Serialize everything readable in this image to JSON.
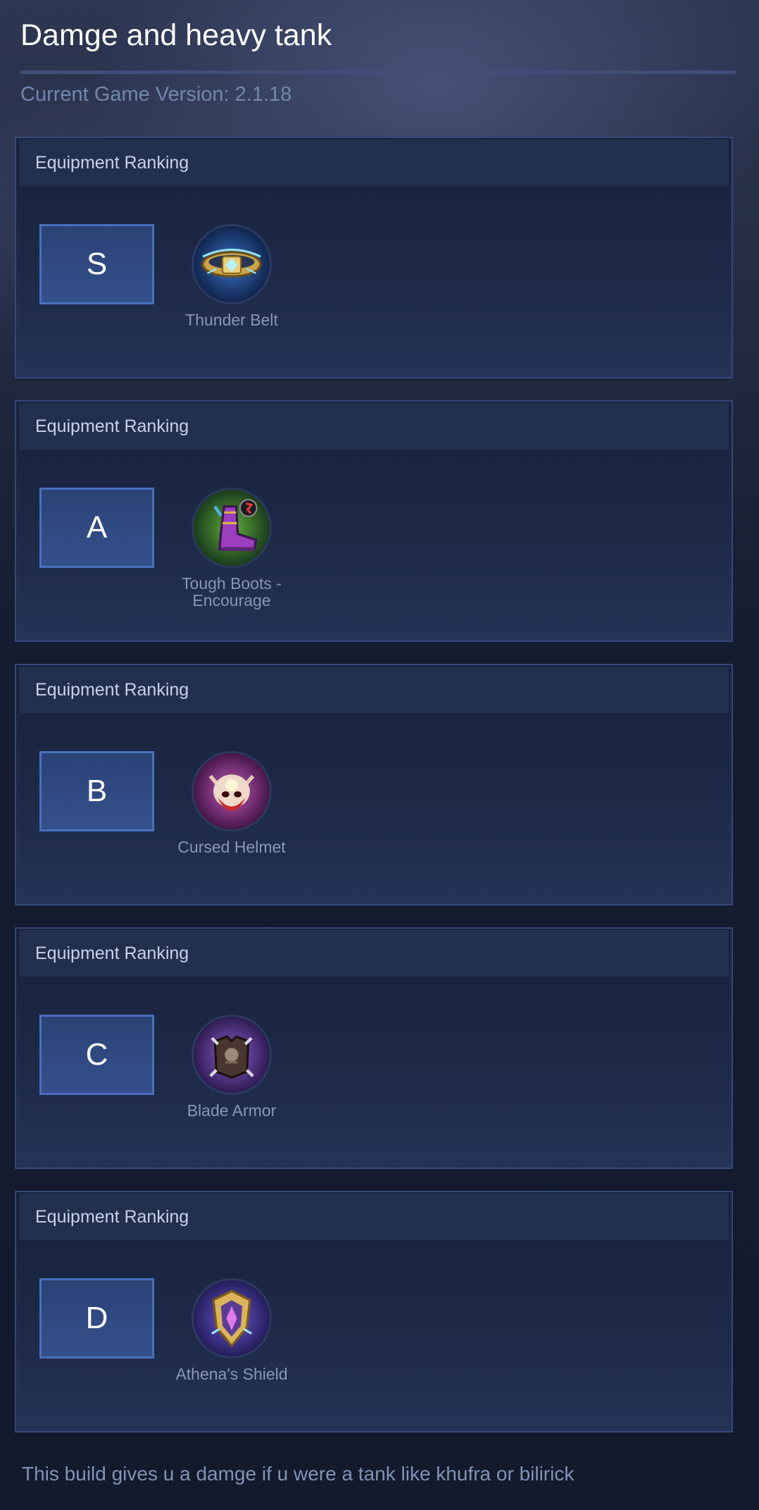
{
  "page": {
    "title": "Damge and heavy tank",
    "version_text": "Current Game Version: 2.1.18",
    "footer": "This build gives u a damge if u were a tank like khufra or bilirick"
  },
  "rankings": [
    {
      "header": "Equipment Ranking",
      "tier": "S",
      "item": "Thunder Belt",
      "icon": "thunder-belt-icon"
    },
    {
      "header": "Equipment Ranking",
      "tier": "A",
      "item": "Tough Boots - Encourage",
      "icon": "tough-boots-icon"
    },
    {
      "header": "Equipment Ranking",
      "tier": "B",
      "item": "Cursed Helmet",
      "icon": "cursed-helmet-icon"
    },
    {
      "header": "Equipment Ranking",
      "tier": "C",
      "item": "Blade Armor",
      "icon": "blade-armor-icon"
    },
    {
      "header": "Equipment Ranking",
      "tier": "D",
      "item": "Athena's Shield",
      "icon": "athenas-shield-icon"
    }
  ],
  "colors": {
    "background": "#131b2e",
    "panel_border": "#34487a",
    "rank_box_border": "#4a6fbd",
    "item_text": "#8797b3"
  }
}
